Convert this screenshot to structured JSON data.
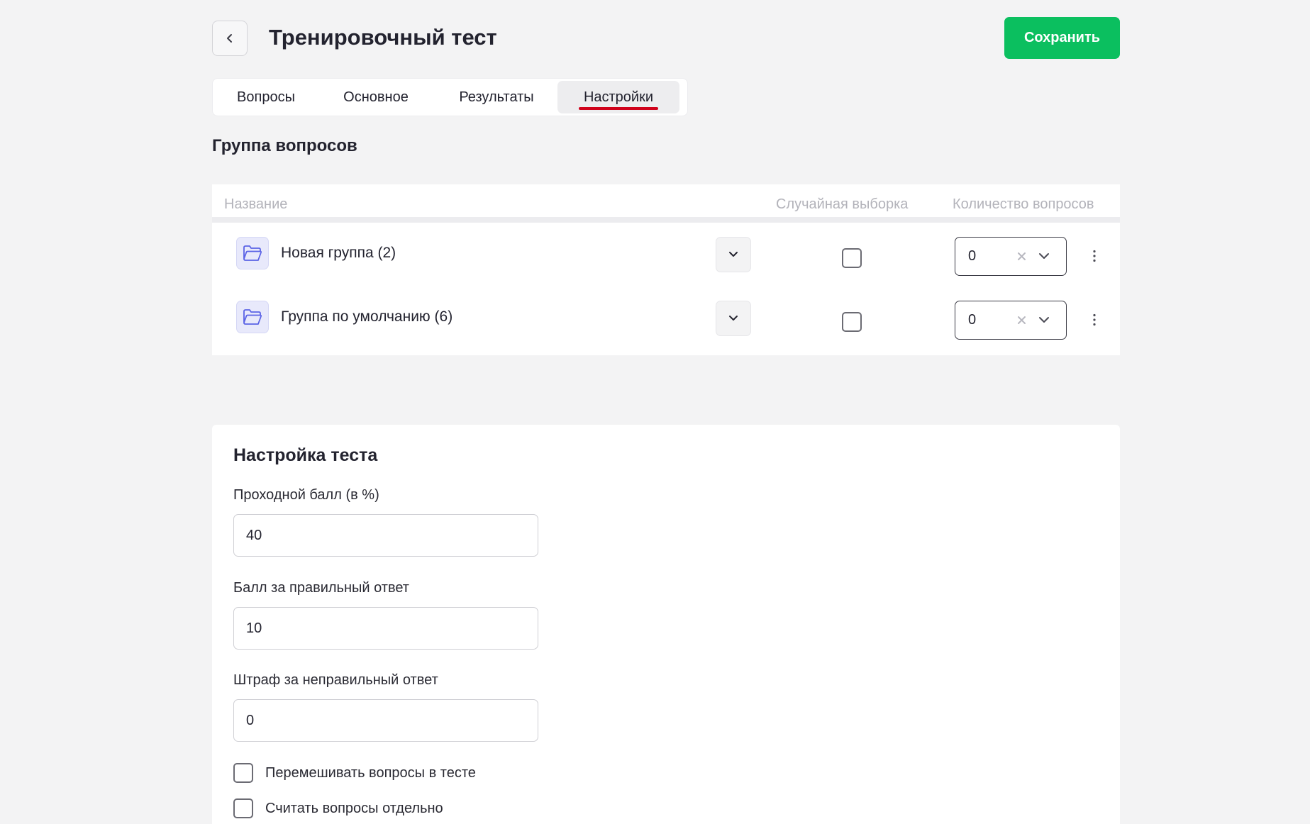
{
  "header": {
    "back_icon": "chevron-left-icon",
    "title": "Тренировочный тест",
    "save_label": "Сохранить"
  },
  "tabs": [
    {
      "label": "Вопросы",
      "active": false
    },
    {
      "label": "Основное",
      "active": false
    },
    {
      "label": "Результаты",
      "active": false
    },
    {
      "label": "Настройки",
      "active": true
    }
  ],
  "groups": {
    "title": "Группа вопросов",
    "columns": {
      "name": "Название",
      "random": "Случайная выборка",
      "count": "Количество вопросов"
    },
    "rows": [
      {
        "name": "Новая группа (2)",
        "random": false,
        "count": "0"
      },
      {
        "name": "Группа по умолчанию (6)",
        "random": false,
        "count": "0"
      }
    ]
  },
  "settings": {
    "title": "Настройка теста",
    "pass_score": {
      "label": "Проходной балл (в %)",
      "value": "40"
    },
    "correct_score": {
      "label": "Балл за правильный ответ",
      "value": "10"
    },
    "penalty": {
      "label": "Штраф за неправильный ответ",
      "value": "0"
    },
    "options": [
      {
        "label": "Перемешивать вопросы в тесте",
        "checked": false
      },
      {
        "label": "Считать вопросы отдельно",
        "checked": false
      }
    ]
  },
  "colors": {
    "accent_green": "#0bbf5f",
    "active_tab_underline": "#d0021b",
    "folder_icon": "#5b63e6",
    "background": "#f3f3f4"
  }
}
